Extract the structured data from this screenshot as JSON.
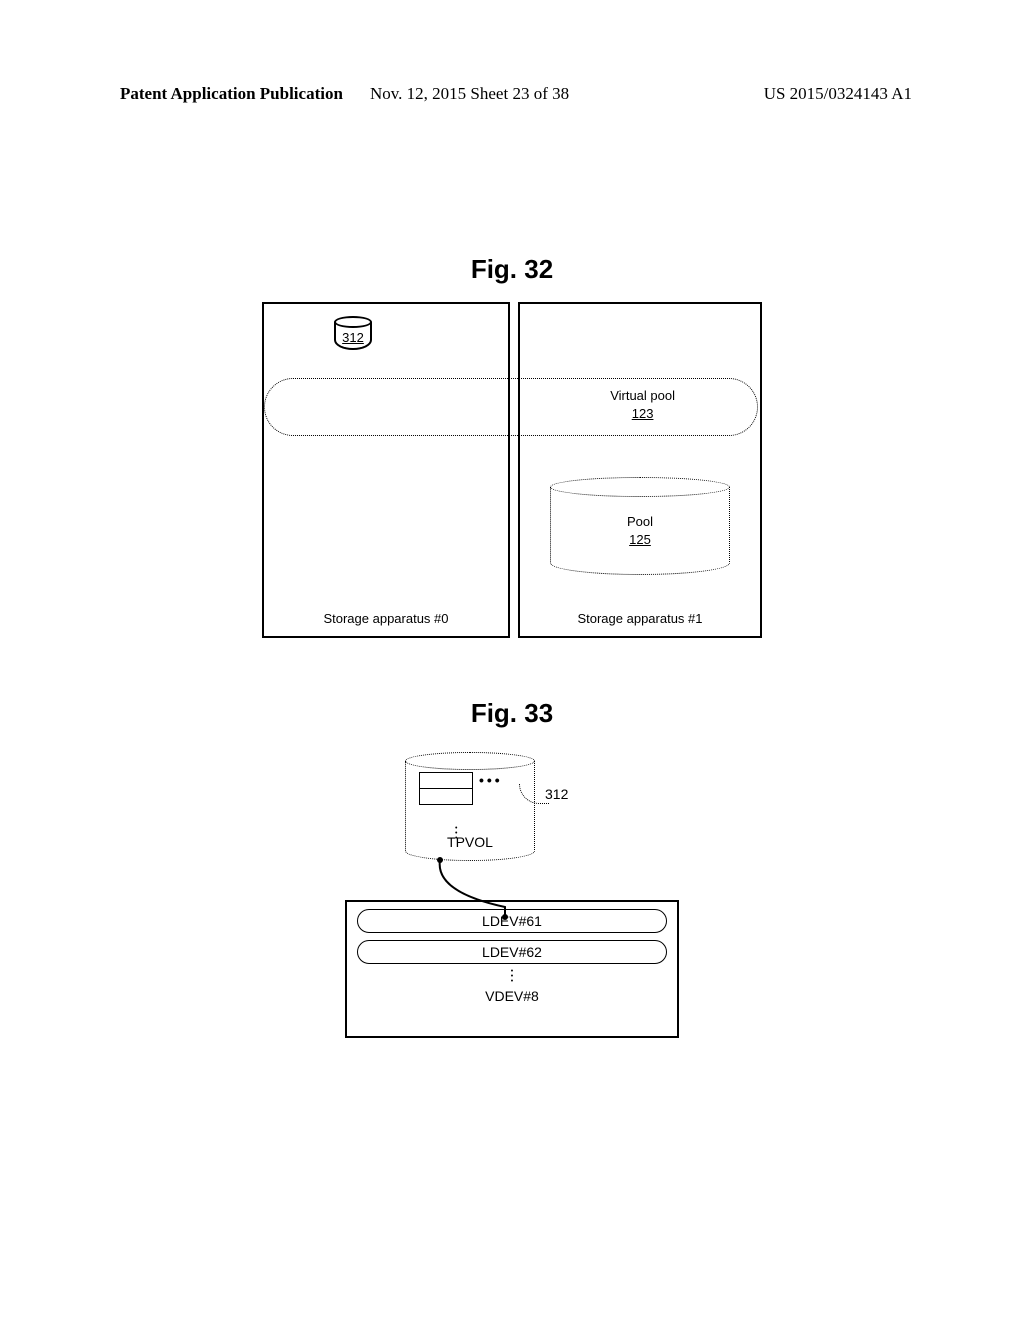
{
  "header": {
    "left": "Patent Application Publication",
    "mid": "Nov. 12, 2015  Sheet 23 of 38",
    "right": "US 2015/0324143 A1"
  },
  "fig32": {
    "title": "Fig. 32",
    "small_cylinder_label": "312",
    "virtual_pool": {
      "line1": "Virtual pool",
      "id": "123"
    },
    "pool": {
      "line1": "Pool",
      "id": "125"
    },
    "apparatus_left": "Storage apparatus #0",
    "apparatus_right": "Storage apparatus #1"
  },
  "fig33": {
    "title": "Fig. 33",
    "tpvol_label": "TPVOL",
    "callout": "312",
    "ldev1": "LDEV#61",
    "ldev2": "LDEV#62",
    "vdev": "VDEV#8"
  },
  "chart_data": [
    {
      "type": "diagram",
      "title": "Fig. 32",
      "components": [
        {
          "name": "Storage apparatus #0",
          "contains": [
            {
              "name": "cylinder",
              "id": 312
            }
          ]
        },
        {
          "name": "Storage apparatus #1",
          "contains": [
            {
              "name": "Pool",
              "id": 125
            }
          ]
        },
        {
          "name": "Virtual pool",
          "id": 123,
          "spans": [
            "Storage apparatus #0",
            "Storage apparatus #1"
          ]
        }
      ]
    },
    {
      "type": "diagram",
      "title": "Fig. 33",
      "components": [
        {
          "name": "TPVOL",
          "id": 312,
          "mapped_to": "LDEV#61"
        },
        {
          "name": "VDEV#8",
          "contains": [
            "LDEV#61",
            "LDEV#62"
          ]
        }
      ]
    }
  ]
}
